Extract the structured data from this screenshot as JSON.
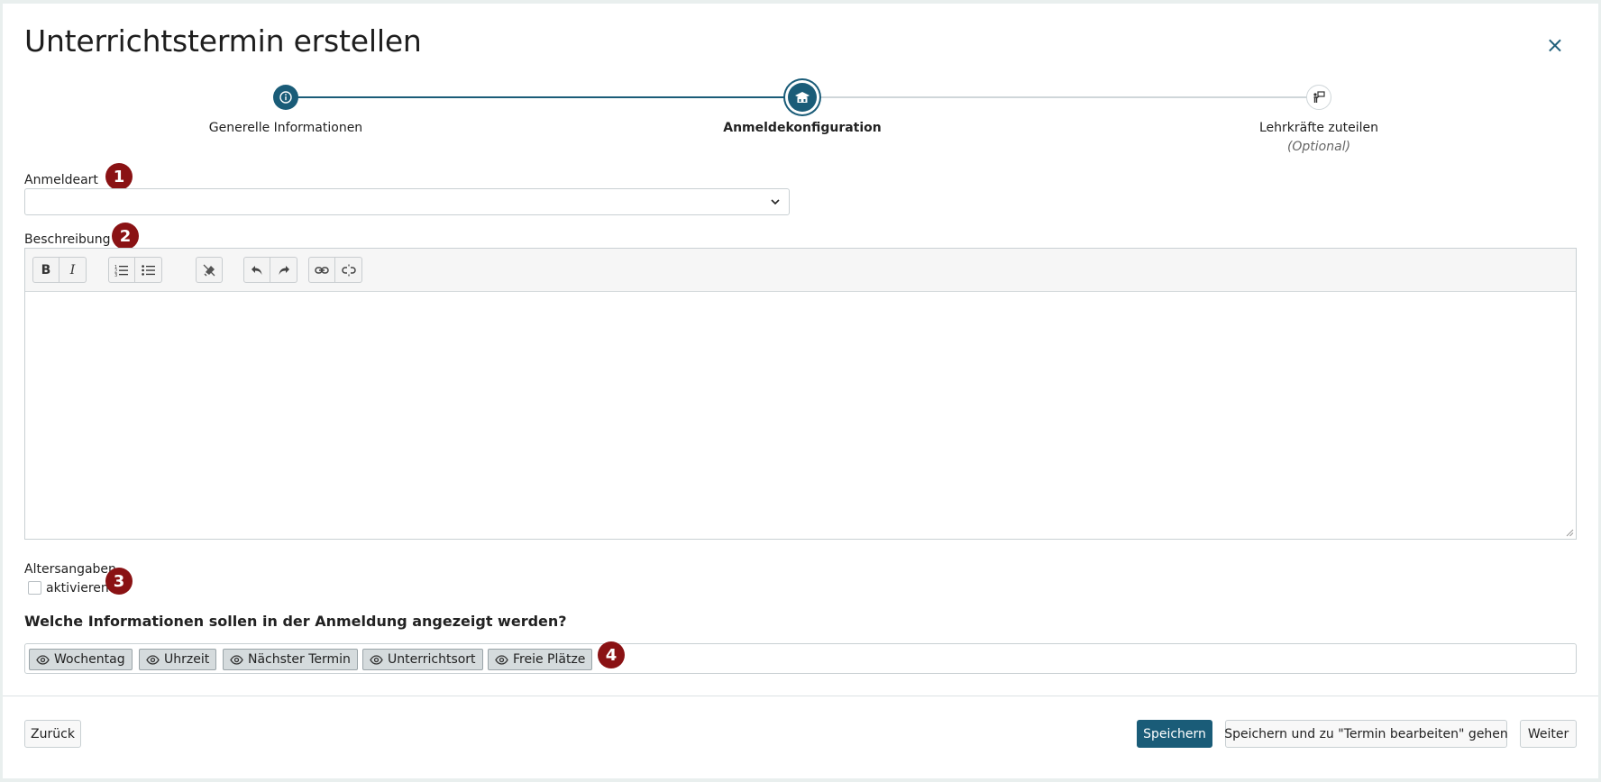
{
  "dialog": {
    "title": "Unterrichtstermin erstellen",
    "close_label": "×"
  },
  "stepper": {
    "steps": [
      {
        "label": "Generelle Informationen",
        "status": "done",
        "icon": "info-icon"
      },
      {
        "label": "Anmeldekonfiguration",
        "status": "active",
        "icon": "school-icon"
      },
      {
        "label": "Lehrkräfte zuteilen",
        "sublabel": "(Optional)",
        "status": "todo",
        "icon": "teacher-board-icon"
      }
    ]
  },
  "markers": [
    "1",
    "2",
    "3",
    "4"
  ],
  "form": {
    "registration_type_label": "Anmeldeart",
    "registration_type_value": "",
    "description_label": "Beschreibung",
    "toolbar": {
      "bold": "B",
      "italic": "I",
      "icons": [
        "numbered-list-icon",
        "bullet-list-icon",
        "clear-format-icon",
        "undo-icon",
        "redo-icon",
        "link-icon",
        "unlink-icon"
      ]
    },
    "age_label": "Altersangaben",
    "age_checkbox_label": "aktivieren",
    "age_checked": false,
    "info_question": "Welche Informationen sollen in der Anmeldung angezeigt werden?",
    "info_tags": [
      "Wochentag",
      "Uhrzeit",
      "Nächster Termin",
      "Unterrichtsort",
      "Freie Plätze"
    ]
  },
  "footer": {
    "back_label": "Zurück",
    "save_label": "Speichern",
    "save_edit_label": "Speichern und zu \"Termin bearbeiten\" gehen",
    "next_label": "Weiter"
  },
  "colors": {
    "primary": "#1a5c78",
    "marker": "#8a1214"
  }
}
